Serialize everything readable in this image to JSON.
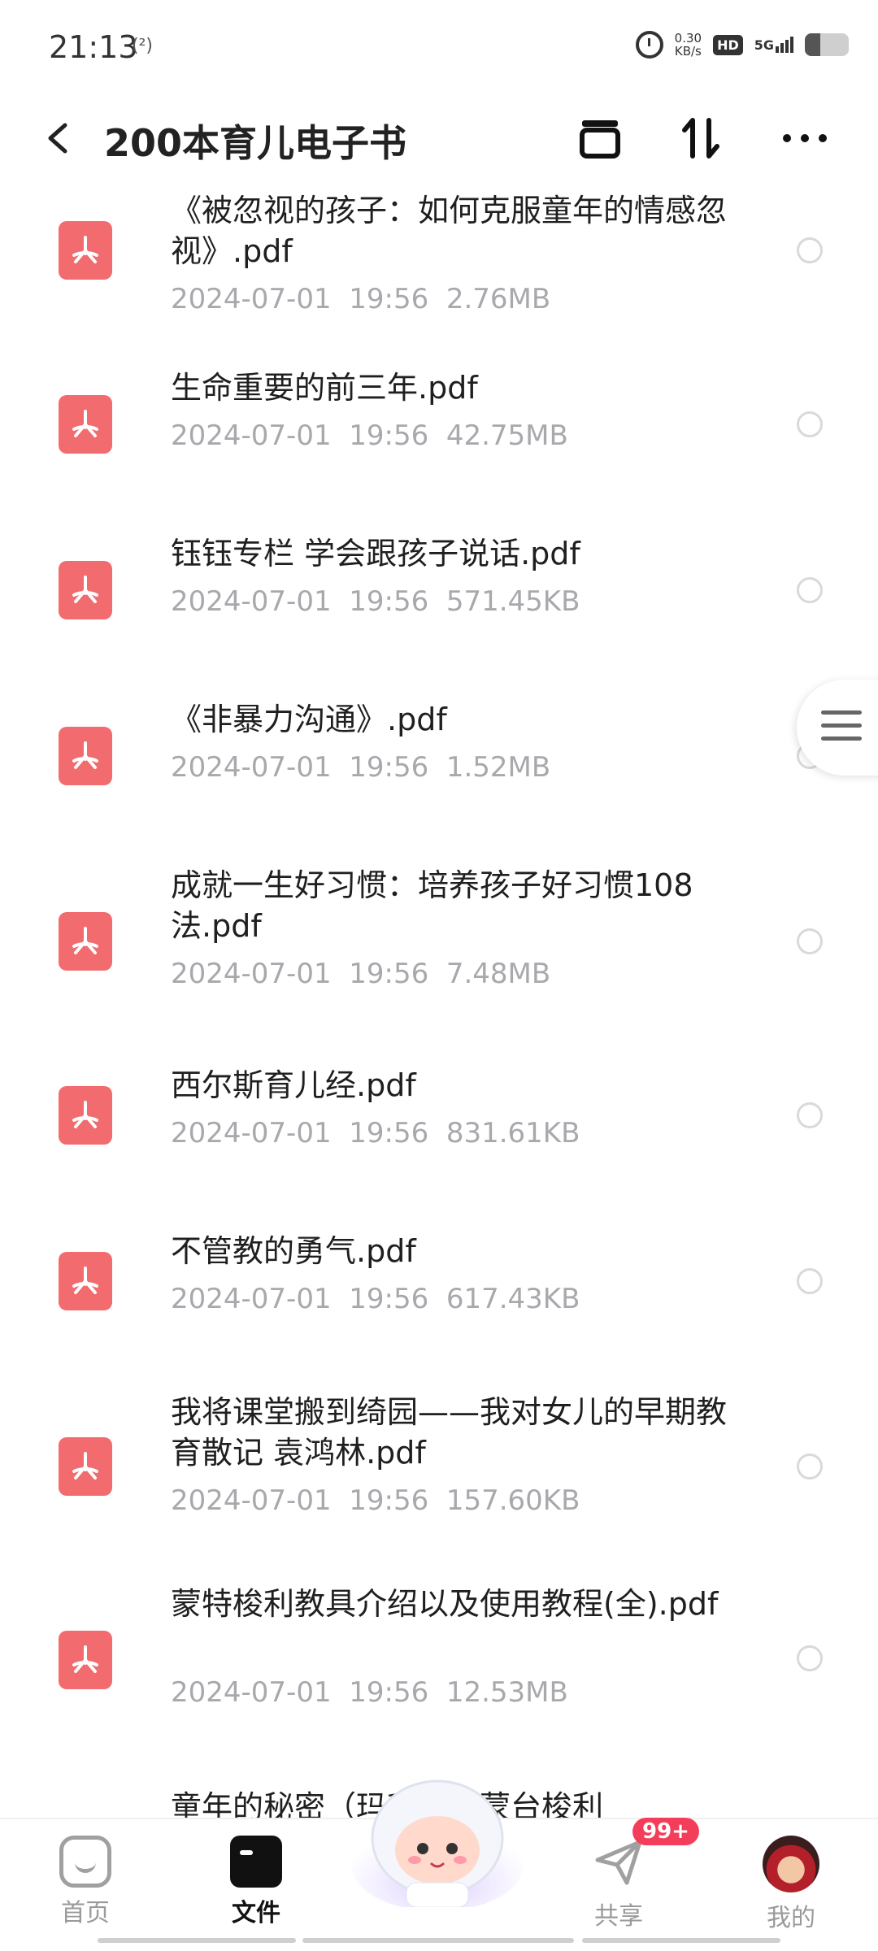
{
  "status_bar": {
    "time": "21:13",
    "signal_small": "(²)",
    "net_speed_value": "0.30",
    "net_speed_unit": "KB/s",
    "hd": "HD",
    "network": "5G",
    "battery_level": 0.35
  },
  "header": {
    "title": "200本育儿电子书"
  },
  "files": [
    {
      "name": "《被忽视的孩子：如何克服童年的情感忽视》.pdf",
      "date": "2024-07-01",
      "time": "19:56",
      "size": "2.76MB"
    },
    {
      "name": "生命重要的前三年.pdf",
      "date": "2024-07-01",
      "time": "19:56",
      "size": "42.75MB"
    },
    {
      "name": "钰钰专栏 学会跟孩子说话.pdf",
      "date": "2024-07-01",
      "time": "19:56",
      "size": "571.45KB"
    },
    {
      "name": "《非暴力沟通》.pdf",
      "date": "2024-07-01",
      "time": "19:56",
      "size": "1.52MB"
    },
    {
      "name": "成就一生好习惯：培养孩子好习惯108法.pdf",
      "date": "2024-07-01",
      "time": "19:56",
      "size": "7.48MB"
    },
    {
      "name": "西尔斯育儿经.pdf",
      "date": "2024-07-01",
      "time": "19:56",
      "size": "831.61KB"
    },
    {
      "name": "不管教的勇气.pdf",
      "date": "2024-07-01",
      "time": "19:56",
      "size": "617.43KB"
    },
    {
      "name": "我将课堂搬到绮园——我对女儿的早期教育散记 袁鸿林.pdf",
      "date": "2024-07-01",
      "time": "19:56",
      "size": "157.60KB"
    },
    {
      "name": "蒙特梭利教具介绍以及使用教程(全).pdf",
      "date": "2024-07-01",
      "time": "19:56",
      "size": "12.53MB"
    },
    {
      "name": "童年的秘密（玛利亚・蒙台梭利",
      "date": "",
      "time": "",
      "size": ""
    }
  ],
  "bottom_nav": {
    "home": "首页",
    "files": "文件",
    "share": "共享",
    "mine": "我的",
    "share_badge": "99+"
  },
  "colors": {
    "pdf_red": "#f26b6e",
    "meta_gray": "#a8a8ad",
    "badge_red": "#f43d5b"
  }
}
